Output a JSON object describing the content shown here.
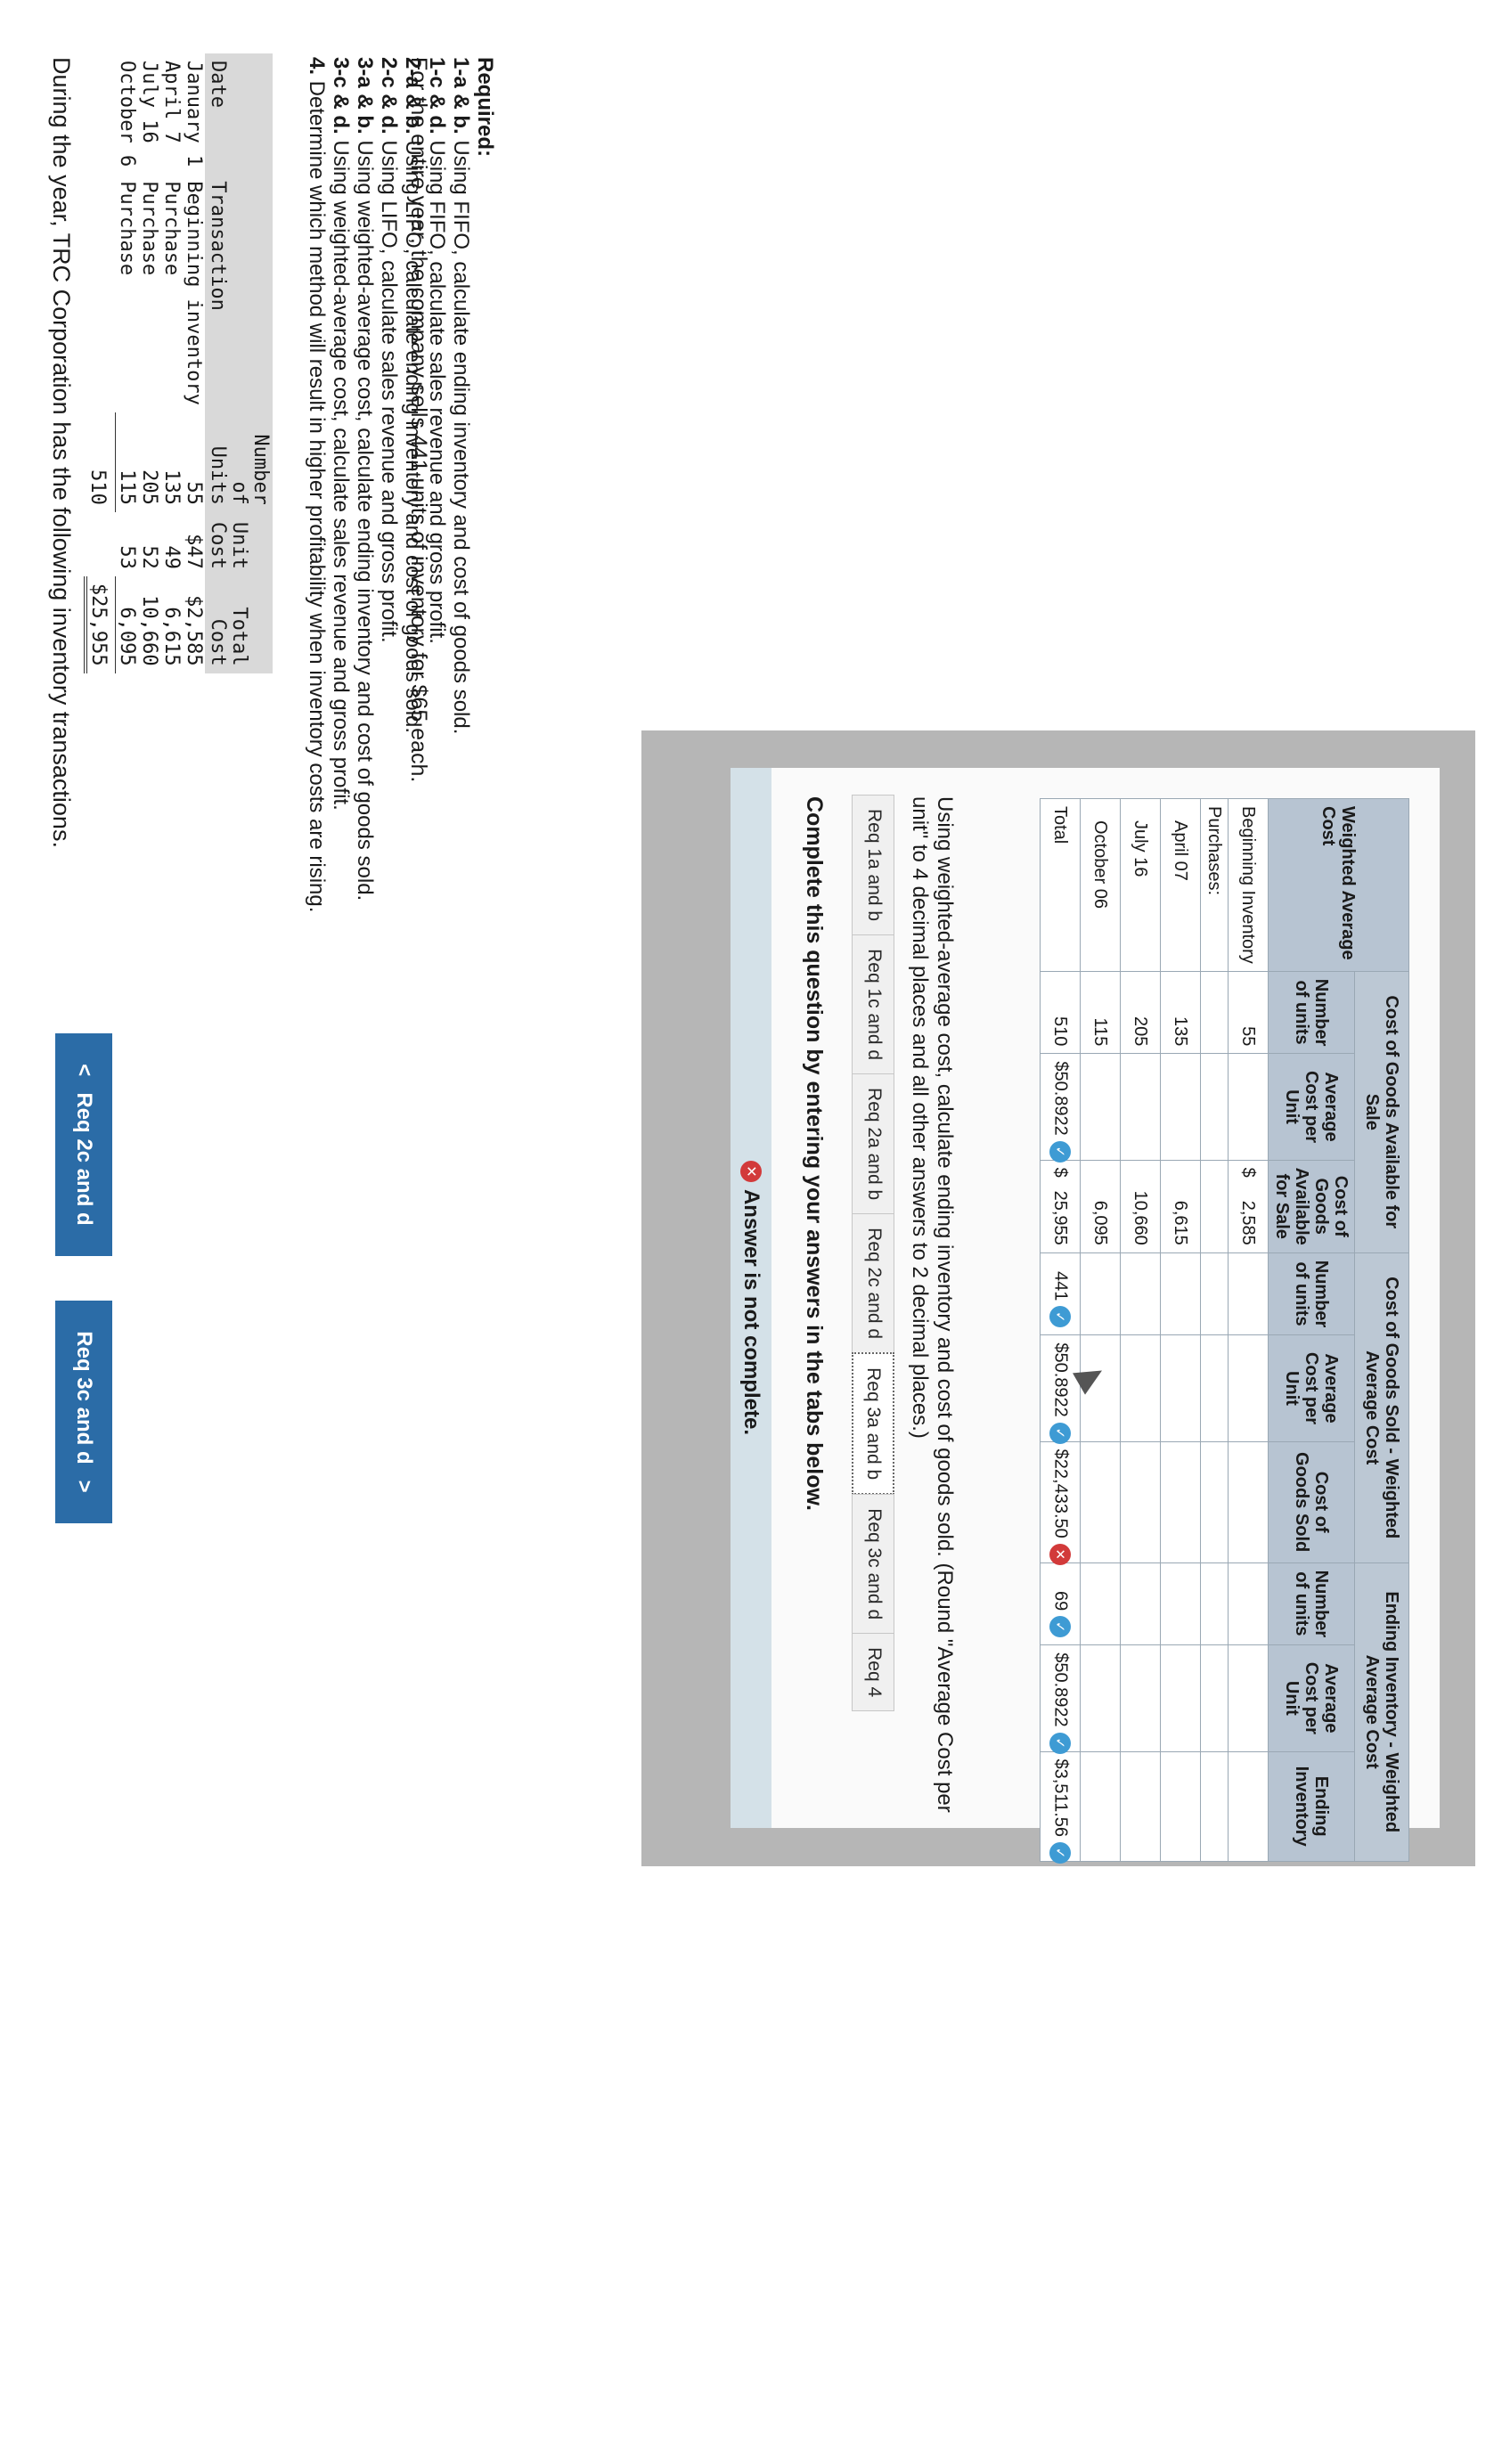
{
  "intro": "During the year, TRC Corporation has the following inventory transactions.",
  "transactions": {
    "headers": {
      "date": "Date",
      "transaction": "Transaction",
      "units": "Number of Units",
      "unit_cost": "Unit Cost",
      "total_cost": "Total Cost"
    },
    "rows": [
      {
        "date": "January 1",
        "transaction": "Beginning inventory",
        "units": "55",
        "unit_cost": "$47",
        "total_cost": "$2,585"
      },
      {
        "date": "April 7",
        "transaction": "Purchase",
        "units": "135",
        "unit_cost": "49",
        "total_cost": "6,615"
      },
      {
        "date": "July 16",
        "transaction": "Purchase",
        "units": "205",
        "unit_cost": "52",
        "total_cost": "10,660"
      },
      {
        "date": "October 6",
        "transaction": "Purchase",
        "units": "115",
        "unit_cost": "53",
        "total_cost": "6,095"
      }
    ],
    "total_units": "510",
    "total_cost": "$25,955"
  },
  "sells_text": "For the entire year, the company sells 441 units of inventory for $65 each.",
  "required": {
    "heading": "Required:",
    "items": [
      {
        "label": "1-a & b.",
        "text": " Using FIFO, calculate ending inventory and cost of goods sold."
      },
      {
        "label": "1-c & d.",
        "text": " Using FIFO, calculate sales revenue and gross profit."
      },
      {
        "label": "2-a & b.",
        "text": " Using LIFO, calculate ending inventory and cost of goods sold."
      },
      {
        "label": "2-c & d.",
        "text": " Using LIFO, calculate sales revenue and gross profit."
      },
      {
        "label": "3-a & b.",
        "text": " Using weighted-average cost, calculate ending inventory and cost of goods sold."
      },
      {
        "label": "3-c & d.",
        "text": " Using weighted-average cost, calculate sales revenue and gross profit."
      },
      {
        "label": "4.",
        "text": " Determine which method will result in higher profitability when inventory costs are rising."
      }
    ]
  },
  "status": "Answer is not complete.",
  "complete_heading": "Complete this question by entering your answers in the tabs below.",
  "tabs": [
    "Req 1a and b",
    "Req 1c and d",
    "Req 2a and b",
    "Req 2c and d",
    "Req 3a and b",
    "Req 3c and d",
    "Req 4"
  ],
  "active_tab": "Req 3a and b",
  "instruction": "Using weighted-average cost, calculate ending inventory and cost of goods sold. (Round \"Average Cost per unit\" to 4 decimal places and all other answers to 2 decimal places.)",
  "table": {
    "title": "Weighted Average Cost",
    "groups": [
      "Cost of Goods Available for Sale",
      "Cost of Goods Sold - Weighted Average Cost",
      "Ending Inventory - Weighted Average Cost"
    ],
    "columns": [
      "Number of units",
      "Average Cost per Unit",
      "Cost of Goods Available for Sale",
      "Number of units",
      "Average Cost per Unit",
      "Cost of Goods Sold",
      "Number of units",
      "Average Cost per Unit",
      "Ending Inventory"
    ],
    "rows": [
      {
        "label": "Beginning Inventory",
        "units": "55",
        "cost": "2,585"
      },
      {
        "label": "Purchases:"
      },
      {
        "label": "April 07",
        "units": "135",
        "cost": "6,615"
      },
      {
        "label": "July 16",
        "units": "205",
        "cost": "10,660"
      },
      {
        "label": "October 06",
        "units": "115",
        "cost": "6,095"
      }
    ],
    "total": {
      "label": "Total",
      "units": "510",
      "avg": "50.8922",
      "available": "25,955",
      "cogs_units": "441",
      "cogs_avg": "50.8922",
      "cogs": "22,433.50",
      "ei_units": "69",
      "ei_avg": "50.8922",
      "ei": "3,511.56"
    },
    "dollar_sign": "$"
  },
  "nav": {
    "prev": "Req 2c and d",
    "next": "Req 3c and d",
    "prev_glyph": "<",
    "next_glyph": ">"
  },
  "colors": {
    "accent": "#2b6ca7",
    "header": "#b7c4d2",
    "check": "#3e9bd4",
    "error": "#d23a3a"
  }
}
